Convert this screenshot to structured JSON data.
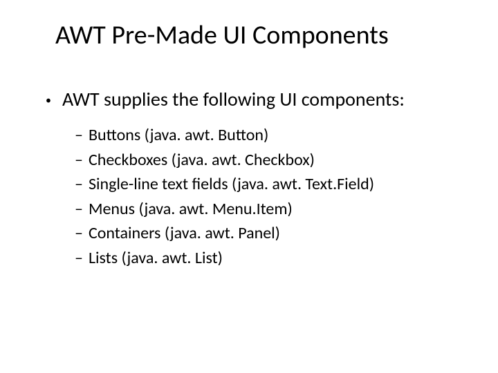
{
  "title": "AWT Pre-Made UI Components",
  "intro": "AWT supplies the following UI components:",
  "items": [
    {
      "text": "Buttons (java. awt. Button)"
    },
    {
      "text": "Checkboxes (java. awt. Checkbox)"
    },
    {
      "text": "Single-line text fields (java. awt. Text.Field)"
    },
    {
      "text": "Menus (java. awt. Menu.Item)"
    },
    {
      "text": "Containers (java. awt. Panel)"
    },
    {
      "text": "Lists (java. awt. List)"
    }
  ]
}
